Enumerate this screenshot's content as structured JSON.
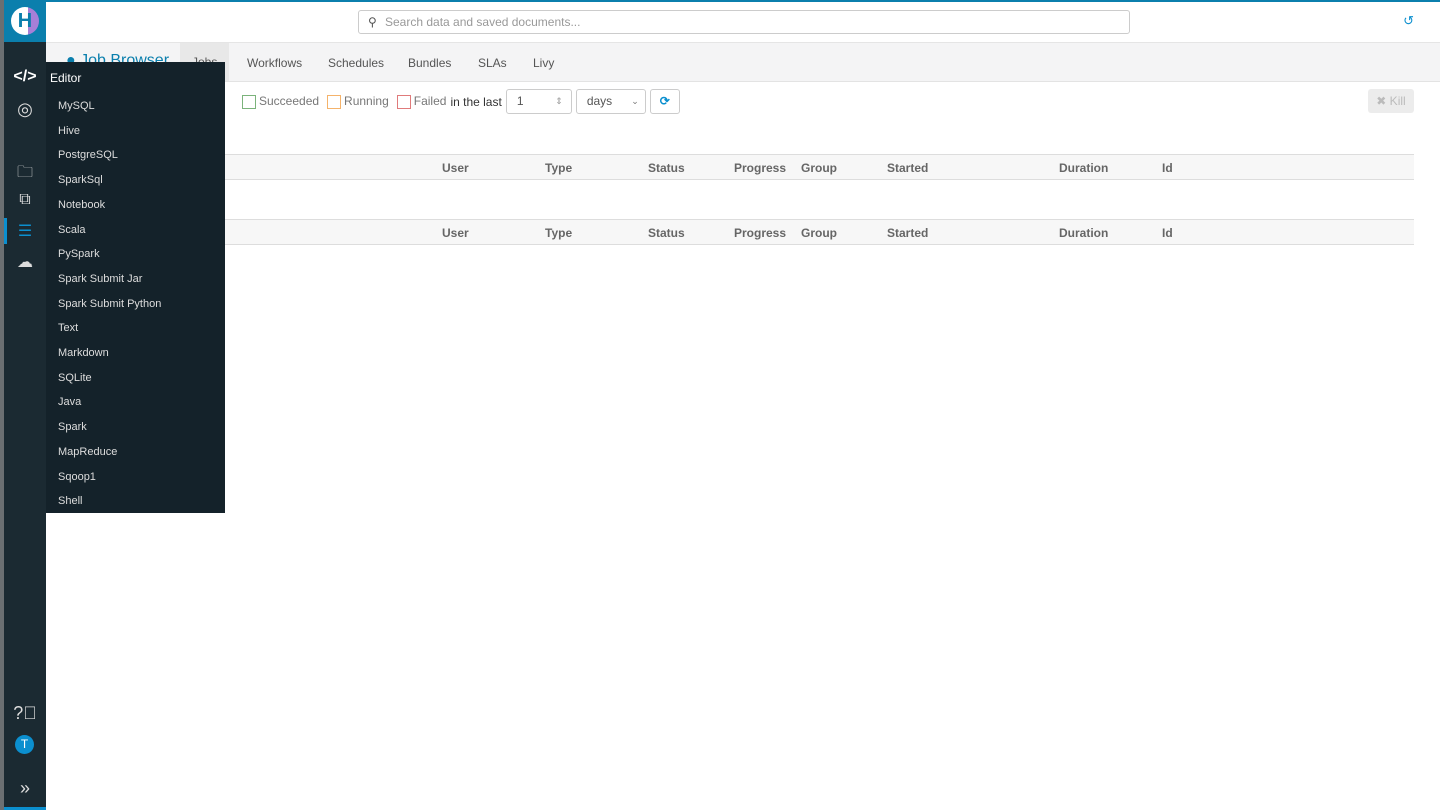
{
  "search": {
    "placeholder": "Search data and saved documents..."
  },
  "app": {
    "title": "Job Browser"
  },
  "tabs": [
    "Jobs",
    "Workflows",
    "Schedules",
    "Bundles",
    "SLAs",
    "Livy"
  ],
  "filters": {
    "succeeded": "Succeeded",
    "running": "Running",
    "failed": "Failed",
    "in_the_last": "in the last",
    "amount": "1",
    "unit": "days",
    "colors": {
      "succeeded": "#5cb85c",
      "running": "#f0ad4e",
      "failed": "#d9534f"
    }
  },
  "kill_label": "✖ Kill",
  "columns": [
    "User",
    "Type",
    "Status",
    "Progress",
    "Group",
    "Started",
    "Duration",
    "Id"
  ],
  "menu": {
    "header": "Editor",
    "items": [
      "MySQL",
      "Hive",
      "PostgreSQL",
      "SparkSql",
      "Notebook",
      "Scala",
      "PySpark",
      "Spark Submit Jar",
      "Spark Submit Python",
      "Text",
      "Markdown",
      "SQLite",
      "Java",
      "Spark",
      "MapReduce",
      "Sqoop1",
      "Shell"
    ]
  },
  "user_initial": "T",
  "accent": "#0b8fcf"
}
